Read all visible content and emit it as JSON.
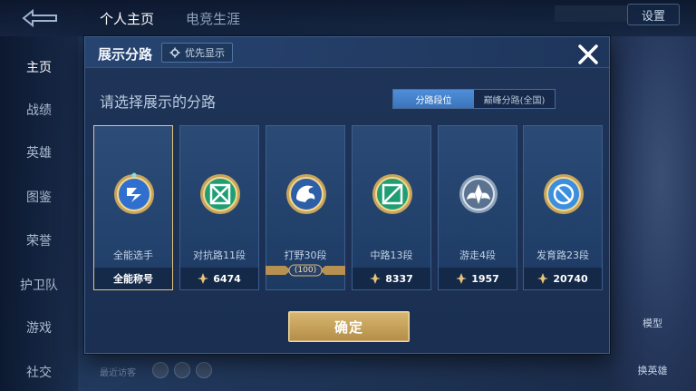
{
  "background": {
    "tabs": [
      "个人主页",
      "电竞生涯"
    ],
    "settings_label": "设置",
    "sidebar_items": [
      "主页",
      "战绩",
      "英雄",
      "图鉴",
      "荣誉",
      "护卫队",
      "游戏",
      "社交"
    ],
    "recent_visitors_label": "最近访客",
    "right_labels": [
      "模型",
      "换英雄"
    ]
  },
  "modal": {
    "title": "展示分路",
    "priority_label": "优先显示",
    "prompt": "请选择展示的分路",
    "toggle": {
      "options": [
        "分路段位",
        "巅峰分路(全国)"
      ],
      "selected": "分路段位"
    },
    "confirm_label": "确定",
    "cards": [
      {
        "name": "全能选手",
        "footer": "全能称号",
        "selected": true,
        "icon": "all-round-icon"
      },
      {
        "name": "对抗路11段",
        "score": "6474",
        "icon": "clash-lane-icon"
      },
      {
        "name": "打野30段",
        "ribbon": "100",
        "icon": "jungle-dragon-icon"
      },
      {
        "name": "中路13段",
        "score": "8337",
        "icon": "mid-lane-icon"
      },
      {
        "name": "游走4段",
        "score": "1957",
        "icon": "roam-wings-icon"
      },
      {
        "name": "发育路23段",
        "score": "20740",
        "icon": "farm-lane-icon"
      }
    ]
  },
  "colors": {
    "gold": "#e7c47a",
    "accent_blue": "#3a74bc",
    "lane_green": "#2fbf8a",
    "lane_blue": "#3b8fe0"
  }
}
